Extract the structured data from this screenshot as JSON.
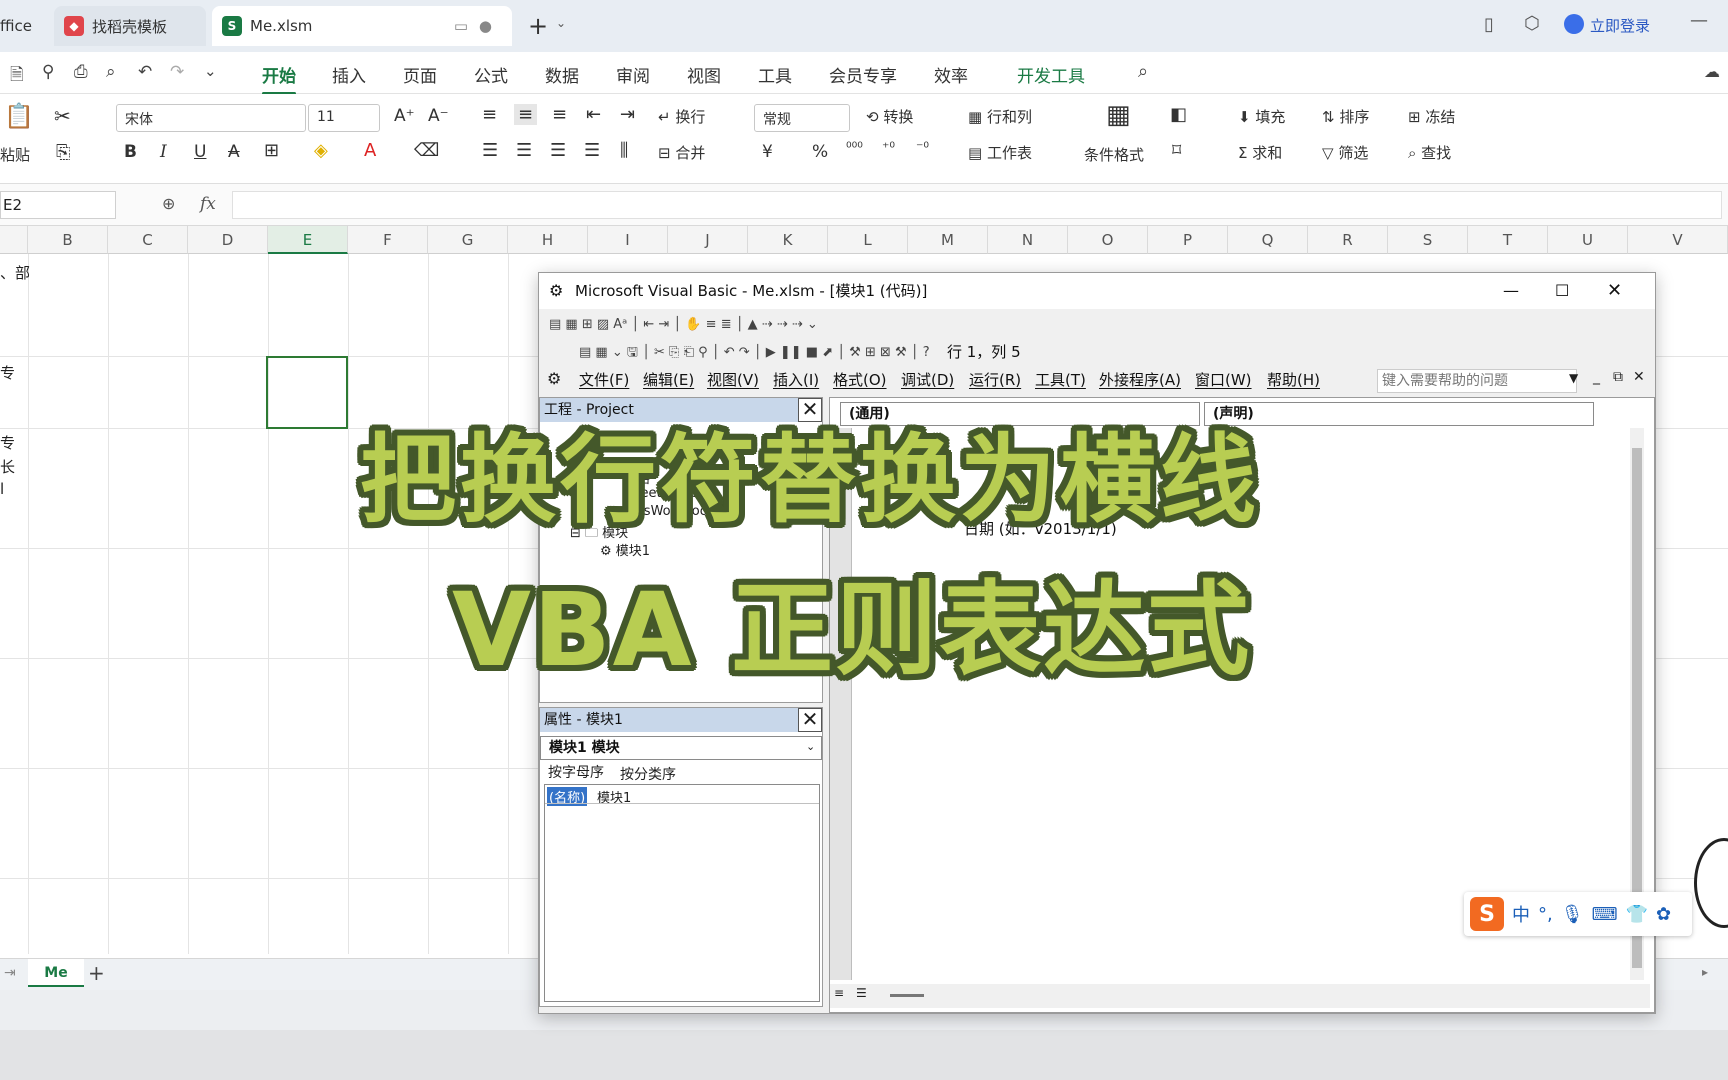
{
  "tabs": [
    {
      "label": "ffice"
    },
    {
      "label": "找稻壳模板"
    },
    {
      "label": "Me.xlsm"
    }
  ],
  "title_right": {
    "login": "立即登录"
  },
  "menu": [
    "开始",
    "插入",
    "页面",
    "公式",
    "数据",
    "审阅",
    "视图",
    "工具",
    "会员专享",
    "效率",
    "开发工具"
  ],
  "ribbon": {
    "paste": "粘贴",
    "font": "宋体",
    "size": "11",
    "wrap": "换行",
    "merge": "合并",
    "numfmt": "常规",
    "convert": "转换",
    "rowcol": "行和列",
    "worksheet": "工作表",
    "condfmt": "条件格式",
    "fill": "填充",
    "sort": "排序",
    "freeze": "冻结",
    "sum": "求和",
    "filter": "筛选",
    "find": "查找",
    "b": "B",
    "i": "I",
    "u": "U",
    "pct": "%",
    "yen": "¥"
  },
  "formula": {
    "cell": "E2",
    "fx": "fx"
  },
  "columns": [
    "B",
    "C",
    "D",
    "E",
    "F",
    "G",
    "H",
    "I",
    "J",
    "K",
    "L",
    "M",
    "N",
    "O",
    "P",
    "Q",
    "R",
    "S",
    "T",
    "U",
    "V"
  ],
  "left_fragments": [
    "、部",
    "专",
    "专",
    "长",
    "l"
  ],
  "sheet_tab": "Me",
  "vba": {
    "title": "Microsoft Visual Basic - Me.xlsm - [模块1 (代码)]",
    "cursorpos": "行 1，列 5",
    "menu": [
      "文件(F)",
      "编辑(E)",
      "视图(V)",
      "插入(I)",
      "格式(O)",
      "调试(D)",
      "运行(R)",
      "工具(T)",
      "外接程序(A)",
      "窗口(W)",
      "帮助(H)"
    ],
    "help_placeholder": "键入需要帮助的问题",
    "project_title": "工程 - Project",
    "tree": [
      "表格",
      "Sheet1 (Me)",
      "ThisWorkbook",
      "模块",
      "模块1"
    ],
    "props_title": "属性 - 模块1",
    "props_combo": "模块1 模块",
    "props_tabs": [
      "按字母序",
      "按分类序"
    ],
    "props_row": {
      "key": "(名称)",
      "value": "模块1"
    },
    "code_combo_left": "(通用)",
    "code_combo_right": "(声明)",
    "code_fragments": [
      "日期 (如：v2013/1/1)"
    ]
  },
  "overlay": {
    "line1": "把换行符替换为横线",
    "line2": "VBA 正则表达式"
  },
  "ime": {
    "mode": "中"
  }
}
